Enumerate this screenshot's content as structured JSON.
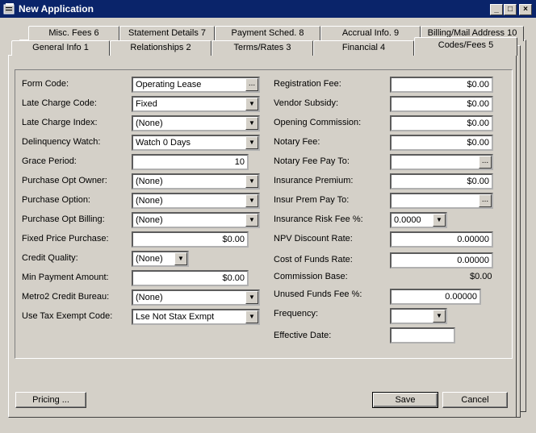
{
  "window": {
    "title": "New Application",
    "min": "_",
    "max": "□",
    "close": "×"
  },
  "tabs_back": [
    "Misc. Fees 6",
    "Statement Details 7",
    "Payment Sched. 8",
    "Accrual Info. 9",
    "Billing/Mail Address 10"
  ],
  "tabs_front": [
    "General Info 1",
    "Relationships 2",
    "Terms/Rates 3",
    "Financial 4",
    "Codes/Fees 5"
  ],
  "left": {
    "form_code": {
      "label": "Form Code:",
      "value": "Operating Lease"
    },
    "late_charge_code": {
      "label": "Late Charge Code:",
      "value": "Fixed"
    },
    "late_charge_index": {
      "label": "Late Charge Index:",
      "value": "(None)"
    },
    "delinquency_watch": {
      "label": "Delinquency Watch:",
      "value": "Watch 0 Days"
    },
    "grace_period": {
      "label": "Grace Period:",
      "value": "10"
    },
    "purchase_opt_owner": {
      "label": "Purchase Opt Owner:",
      "value": "(None)"
    },
    "purchase_option": {
      "label": "Purchase Option:",
      "value": "(None)"
    },
    "purchase_opt_billing": {
      "label": "Purchase Opt Billing:",
      "value": "(None)"
    },
    "fixed_price_purchase": {
      "label": "Fixed Price Purchase:",
      "value": "$0.00"
    },
    "credit_quality": {
      "label": "Credit Quality:",
      "value": "(None)"
    },
    "min_payment_amount": {
      "label": "Min Payment Amount:",
      "value": "$0.00"
    },
    "metro2": {
      "label": "Metro2 Credit Bureau:",
      "value": "(None)"
    },
    "use_tax_exempt": {
      "label": "Use Tax Exempt Code:",
      "value": "Lse Not Stax Exmpt"
    }
  },
  "right": {
    "registration_fee": {
      "label": "Registration Fee:",
      "value": "$0.00"
    },
    "vendor_subsidy": {
      "label": "Vendor Subsidy:",
      "value": "$0.00"
    },
    "opening_commission": {
      "label": "Opening Commission:",
      "value": "$0.00"
    },
    "notary_fee": {
      "label": "Notary Fee:",
      "value": "$0.00"
    },
    "notary_fee_pay_to": {
      "label": "Notary Fee Pay To:",
      "value": ""
    },
    "insurance_premium": {
      "label": "Insurance Premium:",
      "value": "$0.00"
    },
    "insur_prem_pay_to": {
      "label": "Insur Prem Pay To:",
      "value": ""
    },
    "insurance_risk_fee": {
      "label": "Insurance Risk Fee %:",
      "value": "0.0000"
    },
    "npv_discount_rate": {
      "label": "NPV Discount Rate:",
      "value": "0.00000"
    },
    "cost_of_funds_rate": {
      "label": "Cost of Funds Rate:",
      "value": "0.00000"
    },
    "commission_base": {
      "label": "Commission Base:",
      "value": "$0.00"
    },
    "unused_funds_fee": {
      "label": "Unused Funds  Fee %:",
      "value": "0.00000"
    },
    "frequency": {
      "label": "Frequency:",
      "value": ""
    },
    "effective_date": {
      "label": "Effective Date:",
      "value": ""
    }
  },
  "buttons": {
    "pricing": "Pricing ...",
    "save": "Save",
    "cancel": "Cancel"
  },
  "ui": {
    "ellipsis": "...",
    "dropdown": "▼"
  }
}
